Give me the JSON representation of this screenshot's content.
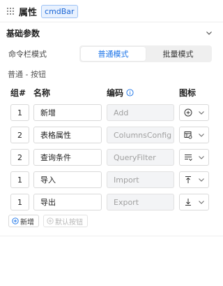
{
  "header": {
    "title": "属性",
    "tag": "cmdBar"
  },
  "section": {
    "title": "基础参数"
  },
  "mode": {
    "label": "命令栏模式",
    "options": [
      "普通模式",
      "批量模式"
    ],
    "selected": "普通模式"
  },
  "subsection": {
    "title": "普通 - 按钮"
  },
  "table": {
    "headers": {
      "group": "组#",
      "name": "名称",
      "code": "编码",
      "icon": "图标"
    },
    "rows": [
      {
        "group": "1",
        "name": "新增",
        "code": "Add",
        "icon": "plus-circle-icon"
      },
      {
        "group": "2",
        "name": "表格属性",
        "code": "ColumnsConfig",
        "icon": "table-settings-icon"
      },
      {
        "group": "2",
        "name": "查询条件",
        "code": "QueryFilter",
        "icon": "filter-lines-icon"
      },
      {
        "group": "1",
        "name": "导入",
        "code": "Import",
        "icon": "upload-icon"
      },
      {
        "group": "1",
        "name": "导出",
        "code": "Export",
        "icon": "download-icon"
      }
    ]
  },
  "buttons": {
    "add": "新增",
    "default": "默认按钮"
  },
  "colors": {
    "accent": "#1a73e8",
    "tag_bg": "#e8f1fe",
    "muted": "#a0a0a0"
  }
}
